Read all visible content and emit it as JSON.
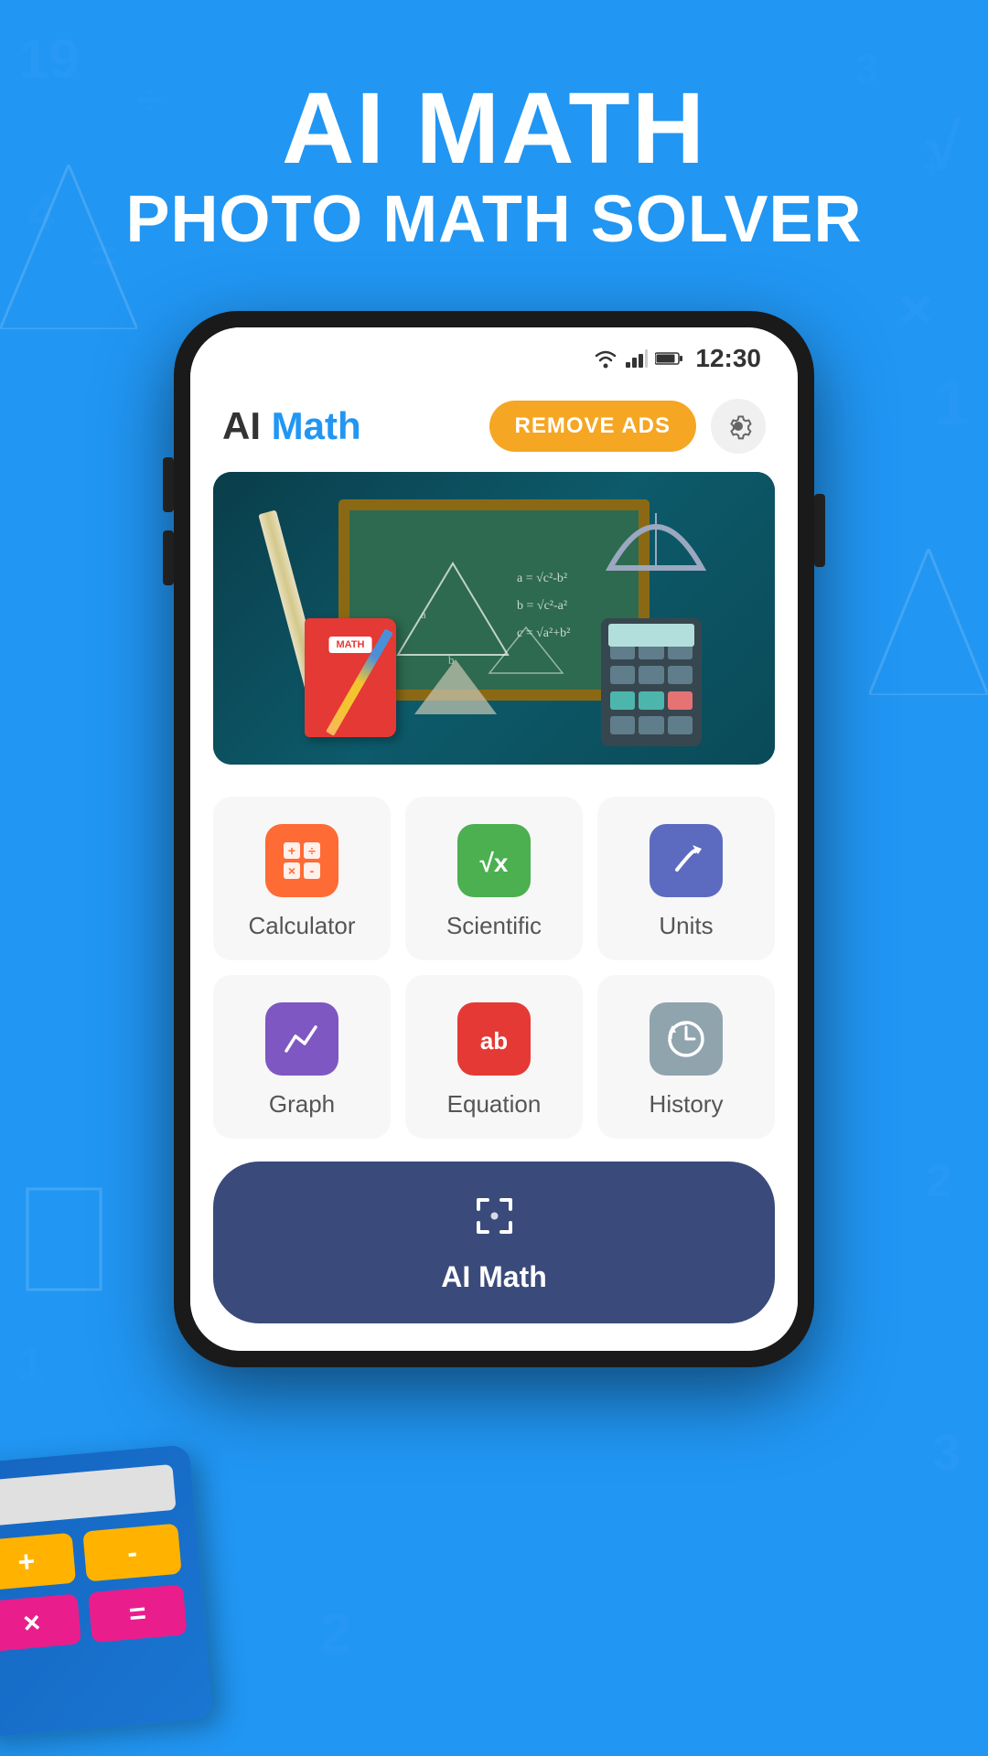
{
  "background_color": "#2196F3",
  "header": {
    "title_bold": "AI MATH",
    "subtitle": "PHOTO MATH SOLVER"
  },
  "status_bar": {
    "time": "12:30",
    "wifi": "▼",
    "signal": "▲",
    "battery": "🔋"
  },
  "app_header": {
    "logo_black": "AI",
    "logo_blue": " Math",
    "remove_ads_label": "REMOVE ADS",
    "settings_icon": "⚙"
  },
  "banner": {
    "alt_text": "Math classroom illustration with chalkboard, calculator, and school supplies"
  },
  "menu": {
    "items": [
      {
        "id": "calculator",
        "label": "Calculator",
        "icon": "🔢",
        "icon_class": "icon-orange"
      },
      {
        "id": "scientific",
        "label": "Scientific",
        "icon": "√x",
        "icon_class": "icon-green"
      },
      {
        "id": "units",
        "label": "Units",
        "icon": "↗",
        "icon_class": "icon-purple"
      },
      {
        "id": "graph",
        "label": "Graph",
        "icon": "📈",
        "icon_class": "icon-violet"
      },
      {
        "id": "equation",
        "label": "Equation",
        "icon": "ab",
        "icon_class": "icon-red"
      },
      {
        "id": "history",
        "label": "History",
        "icon": "🕐",
        "icon_class": "icon-gray"
      }
    ]
  },
  "ai_math_button": {
    "icon": "⊡",
    "label": "AI Math"
  },
  "calc_decoration": {
    "buttons": [
      "+",
      "-",
      "×",
      "="
    ]
  }
}
